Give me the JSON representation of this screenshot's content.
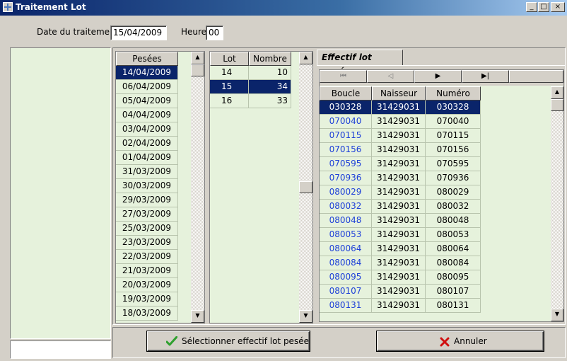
{
  "window": {
    "title": "Traitement Lot",
    "minimize": "_",
    "restore": "□",
    "close": "×"
  },
  "topbar": {
    "date_label": "Date du traitement",
    "date_value": "15/04/2009",
    "heure_label": "Heure",
    "heure_value": "00"
  },
  "pesees": {
    "header": "Pesées",
    "selected_index": 0,
    "items": [
      "14/04/2009",
      "06/04/2009",
      "05/04/2009",
      "04/04/2009",
      "03/04/2009",
      "02/04/2009",
      "01/04/2009",
      "31/03/2009",
      "30/03/2009",
      "29/03/2009",
      "27/03/2009",
      "25/03/2009",
      "23/03/2009",
      "22/03/2009",
      "21/03/2009",
      "20/03/2009",
      "19/03/2009",
      "18/03/2009"
    ]
  },
  "lots": {
    "headers": [
      "Lot",
      "Nombre"
    ],
    "selected_index": 1,
    "rows": [
      [
        "14",
        "10"
      ],
      [
        "15",
        "34"
      ],
      [
        "16",
        "33"
      ]
    ]
  },
  "effectif": {
    "tab_label": "Effectif lot pesée",
    "nav": {
      "first": "⏮",
      "prev": "◁",
      "next": "▶",
      "last": "▶|"
    },
    "headers": [
      "Boucle",
      "Naisseur",
      "Numéro"
    ],
    "selected_index": 0,
    "rows": [
      [
        "030328",
        "31429031",
        "030328"
      ],
      [
        "070040",
        "31429031",
        "070040"
      ],
      [
        "070115",
        "31429031",
        "070115"
      ],
      [
        "070156",
        "31429031",
        "070156"
      ],
      [
        "070595",
        "31429031",
        "070595"
      ],
      [
        "070936",
        "31429031",
        "070936"
      ],
      [
        "080029",
        "31429031",
        "080029"
      ],
      [
        "080032",
        "31429031",
        "080032"
      ],
      [
        "080048",
        "31429031",
        "080048"
      ],
      [
        "080053",
        "31429031",
        "080053"
      ],
      [
        "080064",
        "31429031",
        "080064"
      ],
      [
        "080084",
        "31429031",
        "080084"
      ],
      [
        "080095",
        "31429031",
        "080095"
      ],
      [
        "080107",
        "31429031",
        "080107"
      ],
      [
        "080131",
        "31429031",
        "080131"
      ]
    ]
  },
  "buttons": {
    "select_label": "Sélectionner effectif lot pesée",
    "cancel_label": "Annuler"
  },
  "colors": {
    "list_bg": "#e6f2dc",
    "selection": "#0a246a",
    "link_blue": "#1e40d8"
  }
}
